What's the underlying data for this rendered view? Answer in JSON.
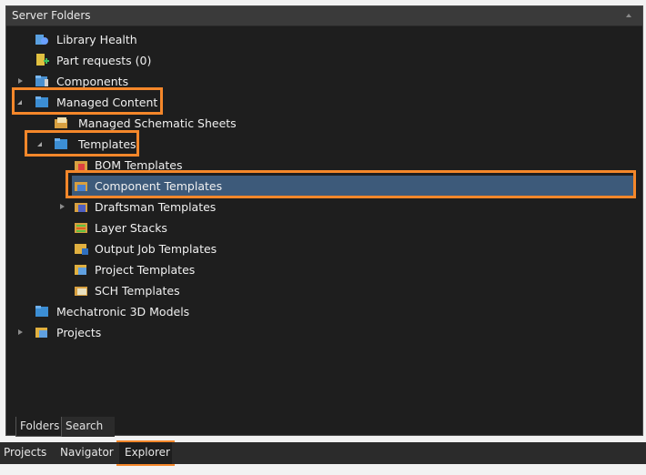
{
  "panel": {
    "title": "Server Folders"
  },
  "tree": [
    {
      "label": "Library Health",
      "icon": "library-health-icon",
      "arrow": "none"
    },
    {
      "label": "Part requests (0)",
      "icon": "part-requests-icon",
      "arrow": "none"
    },
    {
      "label": "Components",
      "icon": "components-folder-icon",
      "arrow": "collapsed"
    },
    {
      "label": "Managed Content",
      "icon": "folder-icon",
      "arrow": "expanded"
    },
    {
      "label": "Managed Schematic Sheets",
      "icon": "schematic-sheets-icon",
      "arrow": "none"
    },
    {
      "label": "Templates",
      "icon": "folder-icon",
      "arrow": "expanded"
    },
    {
      "label": "BOM Templates",
      "icon": "bom-templates-icon",
      "arrow": "none"
    },
    {
      "label": "Component Templates",
      "icon": "component-templates-icon",
      "arrow": "none",
      "selected": true
    },
    {
      "label": "Draftsman Templates",
      "icon": "draftsman-templates-icon",
      "arrow": "collapsed"
    },
    {
      "label": "Layer Stacks",
      "icon": "layer-stacks-icon",
      "arrow": "none"
    },
    {
      "label": "Output Job Templates",
      "icon": "output-job-icon",
      "arrow": "none"
    },
    {
      "label": "Project Templates",
      "icon": "project-templates-icon",
      "arrow": "none"
    },
    {
      "label": "SCH Templates",
      "icon": "sch-templates-icon",
      "arrow": "none"
    },
    {
      "label": "Mechatronic 3D Models",
      "icon": "folder-icon",
      "arrow": "none"
    },
    {
      "label": "Projects",
      "icon": "projects-icon",
      "arrow": "collapsed"
    }
  ],
  "panel_tabs": [
    {
      "label": "Folders",
      "active": true
    },
    {
      "label": "Search",
      "active": false
    }
  ],
  "bottom_tabs": [
    {
      "label": "Projects",
      "active": false
    },
    {
      "label": "Navigator",
      "active": false
    },
    {
      "label": "Explorer",
      "active": true
    }
  ],
  "colors": {
    "highlight": "#f5872a",
    "selection": "#3d5a7a",
    "panel_bg": "#1e1e1e"
  }
}
